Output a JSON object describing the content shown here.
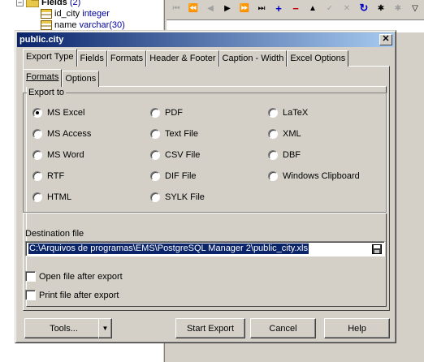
{
  "tree": {
    "fields_label": "Fields",
    "fields_count": "(2)",
    "items": [
      {
        "name": "id_city",
        "type": "integer"
      },
      {
        "name": "name",
        "type": "varchar(30)"
      }
    ]
  },
  "dialog": {
    "title": "public.city",
    "tabs": [
      "Export Type",
      "Fields",
      "Formats",
      "Header & Footer",
      "Caption - Width",
      "Excel Options"
    ],
    "subtabs": [
      "Formats",
      "Options"
    ],
    "export_to": {
      "legend": "Export to",
      "options": [
        {
          "label": "MS Excel",
          "checked": true
        },
        {
          "label": "MS Access",
          "checked": false
        },
        {
          "label": "MS Word",
          "checked": false
        },
        {
          "label": "RTF",
          "checked": false
        },
        {
          "label": "HTML",
          "checked": false
        },
        {
          "label": "PDF",
          "checked": false
        },
        {
          "label": "Text File",
          "checked": false
        },
        {
          "label": "CSV File",
          "checked": false
        },
        {
          "label": "DIF File",
          "checked": false
        },
        {
          "label": "SYLK File",
          "checked": false
        },
        {
          "label": "LaTeX",
          "checked": false
        },
        {
          "label": "XML",
          "checked": false
        },
        {
          "label": "DBF",
          "checked": false
        },
        {
          "label": "Windows Clipboard",
          "checked": false
        }
      ]
    },
    "destination": {
      "label": "Destination file",
      "value": "C:\\Arquivos de programas\\EMS\\PostgreSQL Manager 2\\public_city.xls"
    },
    "checkboxes": [
      {
        "label": "Open file after export",
        "checked": false
      },
      {
        "label": "Print file after export",
        "checked": false
      }
    ],
    "buttons": {
      "tools": "Tools...",
      "start": "Start Export",
      "cancel": "Cancel",
      "help": "Help"
    }
  },
  "icons": {
    "tree": [
      "minus-icon",
      "folder-icon",
      "field-icon"
    ],
    "toolbar": [
      "first-icon",
      "prior-page-icon",
      "prior-icon",
      "next-icon",
      "next-page-icon",
      "last-icon",
      "insert-icon",
      "delete-icon",
      "edit-icon",
      "post-icon",
      "cancel-icon",
      "refresh-icon",
      "asterisk-icon",
      "filter-icon"
    ],
    "dialog": [
      "close-icon",
      "save-file-icon",
      "dropdown-arrow-icon"
    ]
  },
  "colors": {
    "titlebar_start": "#0a246a",
    "titlebar_end": "#a6caf0",
    "face": "#d4d0c8",
    "selection": "#0a246a",
    "tree_type": "#0000a0"
  }
}
